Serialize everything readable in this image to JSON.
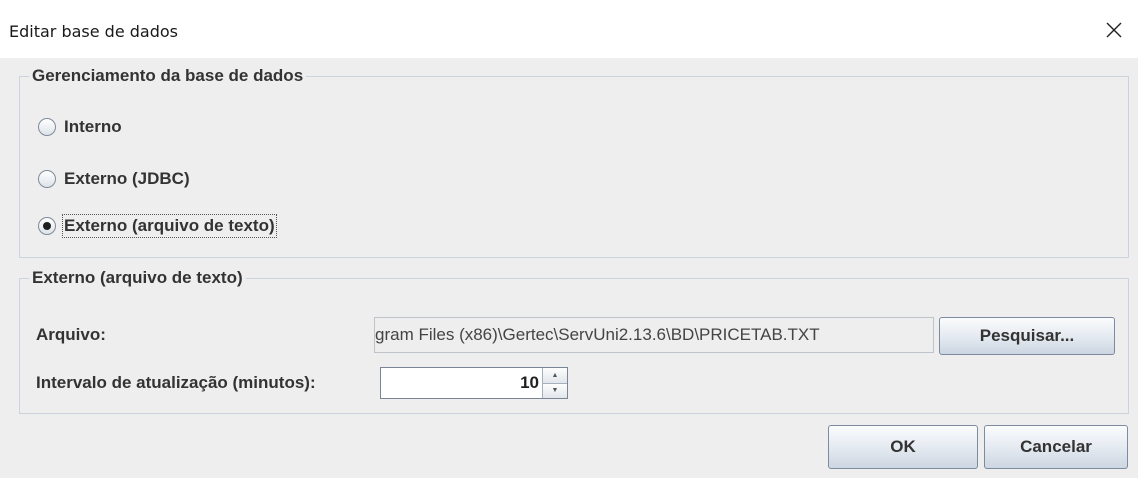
{
  "window": {
    "title": "Editar base de dados",
    "close_icon": "close-icon"
  },
  "management": {
    "legend": "Gerenciamento da base de dados",
    "options": [
      {
        "label": "Interno",
        "checked": false
      },
      {
        "label": "Externo (JDBC)",
        "checked": false
      },
      {
        "label": "Externo (arquivo de texto)",
        "checked": true
      }
    ]
  },
  "external_text": {
    "legend": "Externo (arquivo de texto)",
    "file_label": "Arquivo:",
    "file_path_visible": "gram Files (x86)\\Gertec\\ServUni2.13.6\\BD\\PRICETAB.TXT",
    "browse_label": "Pesquisar...",
    "interval_label": "Intervalo de atualização (minutos):",
    "interval_value": "10"
  },
  "footer": {
    "ok_label": "OK",
    "cancel_label": "Cancelar"
  },
  "colors": {
    "dialog_bg": "#eeeeee",
    "group_border": "#cdd3dc",
    "button_border": "#7c8ba0"
  }
}
